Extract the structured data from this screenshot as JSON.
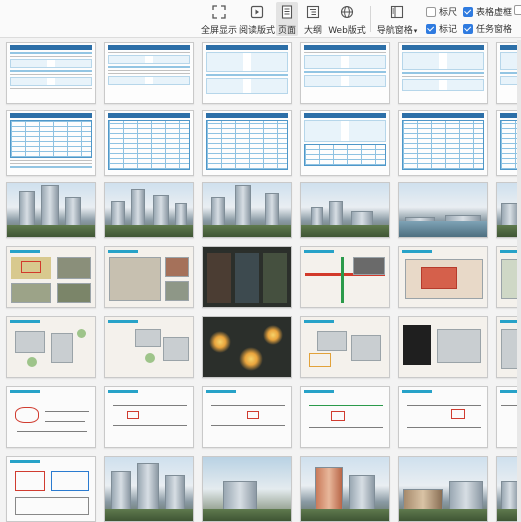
{
  "toolbar": {
    "buttons": [
      {
        "label": "全屏显示",
        "icon": "fullscreen-icon"
      },
      {
        "label": "阅读版式",
        "icon": "reading-layout-icon"
      },
      {
        "label": "页面",
        "icon": "page-view-icon",
        "active": true
      },
      {
        "label": "大纲",
        "icon": "outline-icon"
      },
      {
        "label": "Web版式",
        "icon": "web-layout-icon"
      },
      {
        "label": "导航窗格",
        "icon": "navigation-pane-icon",
        "has_dropdown": true
      }
    ],
    "checkboxes": [
      {
        "label": "标尺",
        "checked": false
      },
      {
        "label": "表格虚框",
        "checked": true
      },
      {
        "label": "标记",
        "checked": true
      },
      {
        "label": "任务窗格",
        "checked": true
      }
    ]
  },
  "colors": {
    "accent": "#2f7be0",
    "doc_blue": "#2c6fa8",
    "highlight_red": "#d23a2b"
  }
}
